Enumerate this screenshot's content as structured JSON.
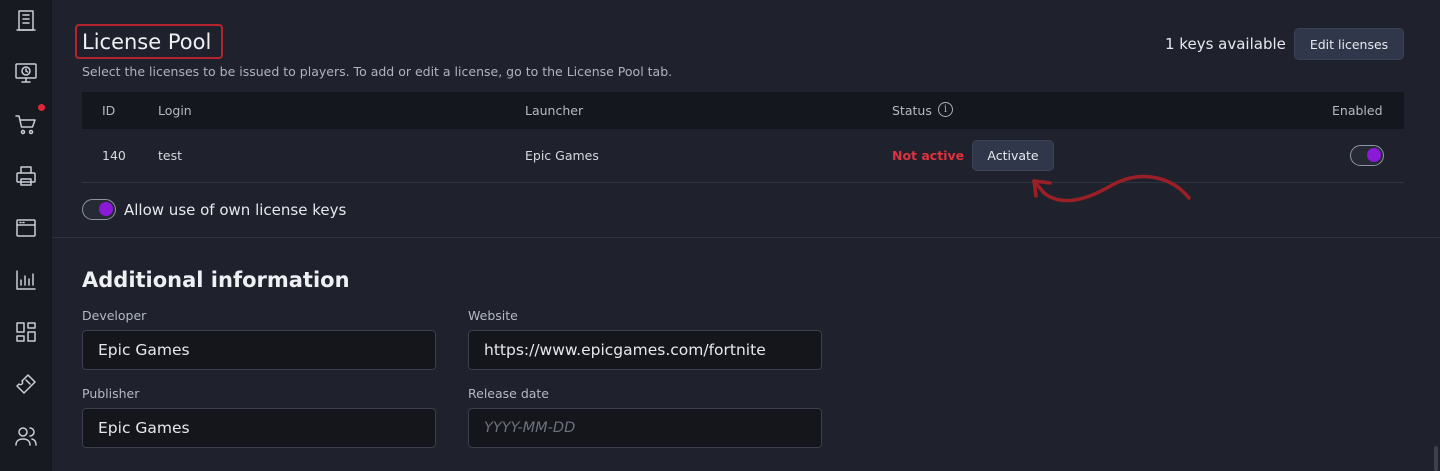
{
  "sidebar": {
    "icons": [
      "building-icon",
      "monitor-icon",
      "cart-icon",
      "printer-icon",
      "window-icon",
      "chart-icon",
      "dashboard-icon",
      "ticket-icon",
      "users-icon"
    ]
  },
  "license_pool": {
    "title": "License Pool",
    "subtitle": "Select the licenses to be issued to players. To add or edit a license, go to the License Pool tab.",
    "keys_available": "1 keys available",
    "edit_button": "Edit licenses",
    "columns": {
      "id": "ID",
      "login": "Login",
      "launcher": "Launcher",
      "status": "Status",
      "enabled": "Enabled"
    },
    "status_info_icon": "i",
    "rows": [
      {
        "id": "140",
        "login": "test",
        "launcher": "Epic Games",
        "status": "Not active",
        "action": "Activate",
        "enabled": true
      }
    ],
    "own_keys_label": "Allow use of own license keys",
    "own_keys_enabled": true
  },
  "additional_info": {
    "title": "Additional information",
    "developer_label": "Developer",
    "developer_value": "Epic Games",
    "website_label": "Website",
    "website_value": "https://www.epicgames.com/fortnite",
    "publisher_label": "Publisher",
    "publisher_value": "Epic Games",
    "release_label": "Release date",
    "release_placeholder": "YYYY-MM-DD"
  },
  "colors": {
    "accent_toggle": "#8a19d8",
    "status_inactive": "#e0323e",
    "highlight": "#b3242e"
  }
}
